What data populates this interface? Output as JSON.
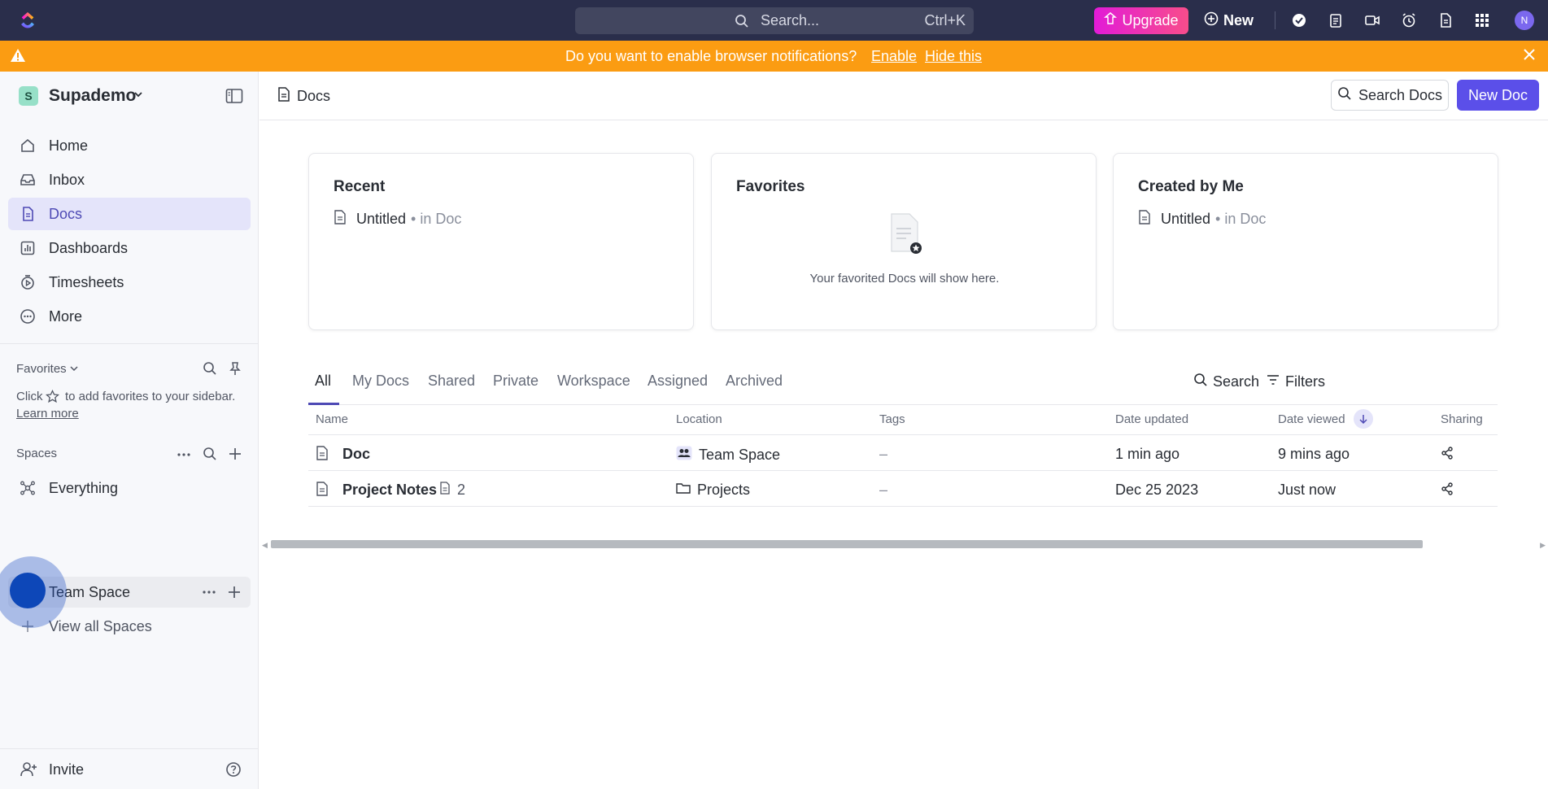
{
  "topbar": {
    "search_placeholder": "Search...",
    "search_shortcut": "Ctrl+K",
    "upgrade_label": "Upgrade",
    "new_label": "New",
    "avatar_initial": "N"
  },
  "banner": {
    "message": "Do you want to enable browser notifications?",
    "enable_label": "Enable",
    "hide_label": "Hide this"
  },
  "sidebar": {
    "workspace_initial": "S",
    "workspace_name": "Supademo",
    "nav": [
      {
        "label": "Home",
        "icon": "home-icon"
      },
      {
        "label": "Inbox",
        "icon": "inbox-icon"
      },
      {
        "label": "Docs",
        "icon": "doc-icon",
        "active": true
      },
      {
        "label": "Dashboards",
        "icon": "dashboard-icon"
      },
      {
        "label": "Timesheets",
        "icon": "timesheet-icon"
      },
      {
        "label": "More",
        "icon": "more-icon"
      }
    ],
    "favorites_title": "Favorites",
    "favorites_hint_pre": "Click",
    "favorites_hint_post": "to add favorites to your sidebar.",
    "learn_more": "Learn more",
    "spaces_title": "Spaces",
    "spaces": [
      {
        "label": "Everything",
        "icon": "everything-icon"
      },
      {
        "label": "Team Space",
        "icon": "team-space-icon"
      },
      {
        "label": "View all Spaces",
        "icon": "plus-icon"
      }
    ],
    "invite_label": "Invite"
  },
  "main": {
    "breadcrumb": "Docs",
    "search_docs_label": "Search Docs",
    "new_doc_label": "New Doc",
    "cards": {
      "recent": {
        "title": "Recent",
        "item": "Untitled",
        "suffix": "• in Doc"
      },
      "favorites": {
        "title": "Favorites",
        "empty_text": "Your favorited Docs will show here."
      },
      "created": {
        "title": "Created by Me",
        "item": "Untitled",
        "suffix": "• in Doc"
      }
    },
    "tabs": [
      "All",
      "My Docs",
      "Shared",
      "Private",
      "Workspace",
      "Assigned",
      "Archived"
    ],
    "search_label": "Search",
    "filters_label": "Filters",
    "columns": [
      "Name",
      "Location",
      "Tags",
      "Date updated",
      "Date viewed",
      "Sharing"
    ],
    "rows": [
      {
        "name": "Doc",
        "sub_count": "",
        "location": "Team Space",
        "tags": "–",
        "updated": "1 min ago",
        "viewed": "9 mins ago"
      },
      {
        "name": "Project Notes",
        "sub_count": "2",
        "location": "Projects",
        "tags": "–",
        "updated": "Dec 25 2023",
        "viewed": "Just now"
      }
    ]
  },
  "colors": {
    "topbar_bg": "#2a2e4b",
    "banner_bg": "#fb9c12",
    "accent": "#5b4fe9",
    "active_nav_bg": "#e4e4fa"
  }
}
